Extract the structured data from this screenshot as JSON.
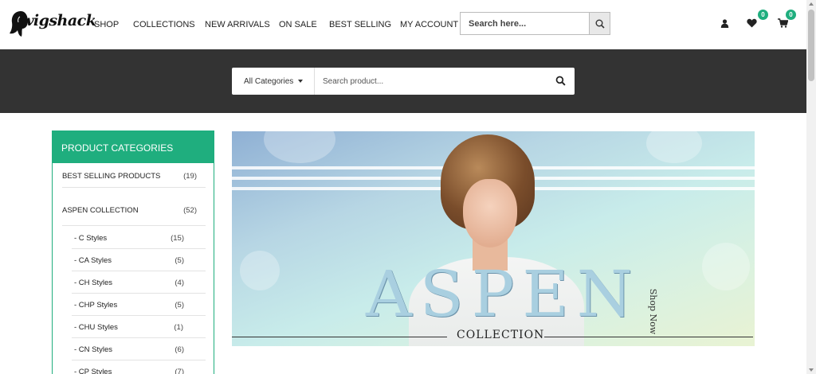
{
  "header": {
    "logo_text": "wigshack",
    "nav": [
      {
        "label": "SHOP"
      },
      {
        "label": "COLLECTIONS"
      },
      {
        "label": "NEW ARRIVALS"
      },
      {
        "label": "ON SALE"
      },
      {
        "label": "BEST SELLING"
      },
      {
        "label": "MY ACCOUNT"
      }
    ],
    "search_placeholder": "Search here...",
    "wishlist_count": "0",
    "cart_count": "0",
    "accent_color": "#1fae7e"
  },
  "product_search": {
    "category": "All Categories",
    "placeholder": "Search product..."
  },
  "sidebar": {
    "title": "PRODUCT CATEGORIES",
    "categories": [
      {
        "name": "BEST SELLING PRODUCTS",
        "count": "(19)"
      },
      {
        "name": "ASPEN COLLECTION",
        "count": "(52)"
      }
    ],
    "subcategories": [
      {
        "name": "- C Styles",
        "count": "(15)"
      },
      {
        "name": "- CA Styles",
        "count": "(5)"
      },
      {
        "name": "- CH Styles",
        "count": "(4)"
      },
      {
        "name": "- CHP Styles",
        "count": "(5)"
      },
      {
        "name": "- CHU Styles",
        "count": "(1)"
      },
      {
        "name": "- CN Styles",
        "count": "(6)"
      },
      {
        "name": "- CP Styles",
        "count": "(7)"
      }
    ]
  },
  "banner": {
    "headline": "ASPEN",
    "cta": "Shop Now",
    "subtitle": "COLLECTION"
  },
  "icons": [
    "search-icon",
    "user-icon",
    "heart-icon",
    "cart-icon",
    "caret-down-icon"
  ]
}
